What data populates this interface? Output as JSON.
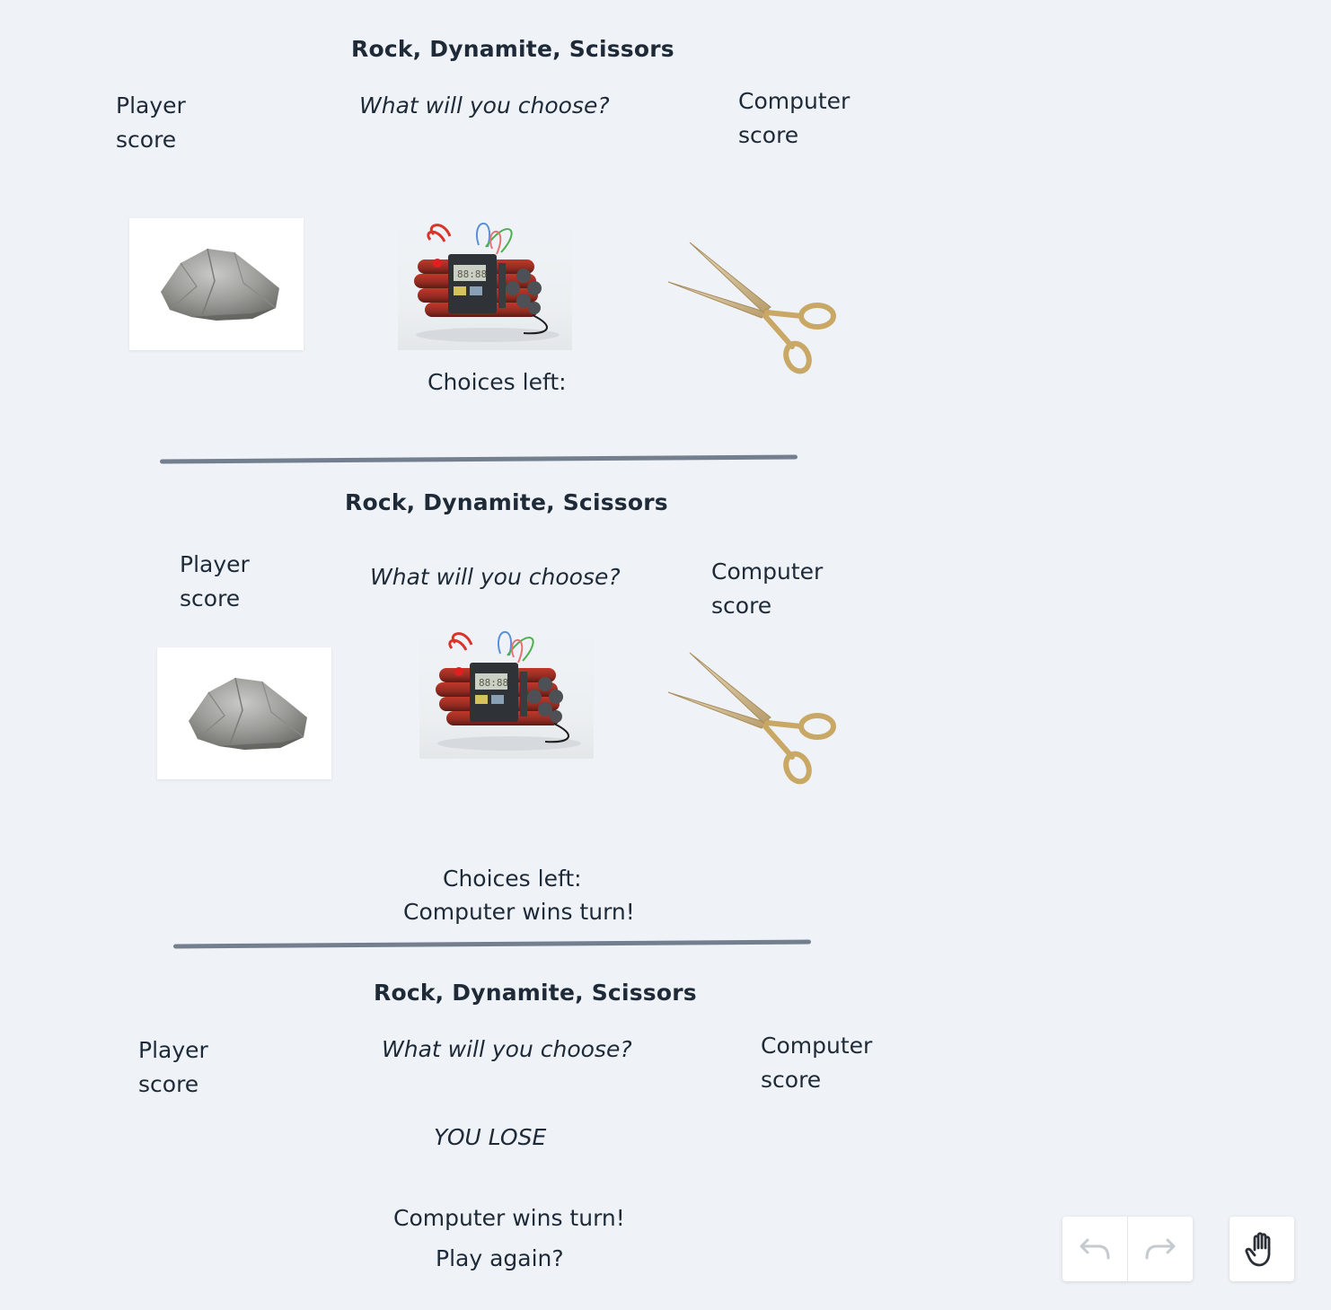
{
  "games": [
    {
      "title": "Rock, Dynamite, Scissors",
      "player_score_label": "Player score",
      "prompt": "What will you choose?",
      "computer_score_label": "Computer score",
      "choices": [
        "rock-icon",
        "dynamite-icon",
        "scissors-icon"
      ],
      "choices_left_label": "Choices left:"
    },
    {
      "title": "Rock, Dynamite, Scissors",
      "player_score_label": "Player score",
      "prompt": "What will you choose?",
      "computer_score_label": "Computer score",
      "choices": [
        "rock-icon",
        "dynamite-icon",
        "scissors-icon"
      ],
      "choices_left_label": "Choices left:",
      "turn_result": "Computer wins turn!"
    },
    {
      "title": "Rock, Dynamite, Scissors",
      "player_score_label": "Player score",
      "prompt": "What will you choose?",
      "computer_score_label": "Computer score",
      "game_result": "YOU LOSE",
      "turn_result": "Computer wins turn!",
      "play_again": "Play again?"
    }
  ],
  "toolbar": {
    "undo_icon": "undo-icon",
    "redo_icon": "redo-icon",
    "hand_icon": "hand-icon"
  },
  "colors": {
    "background": "#eff3f7",
    "text": "#1e2a38",
    "divider": "#737f8f"
  }
}
